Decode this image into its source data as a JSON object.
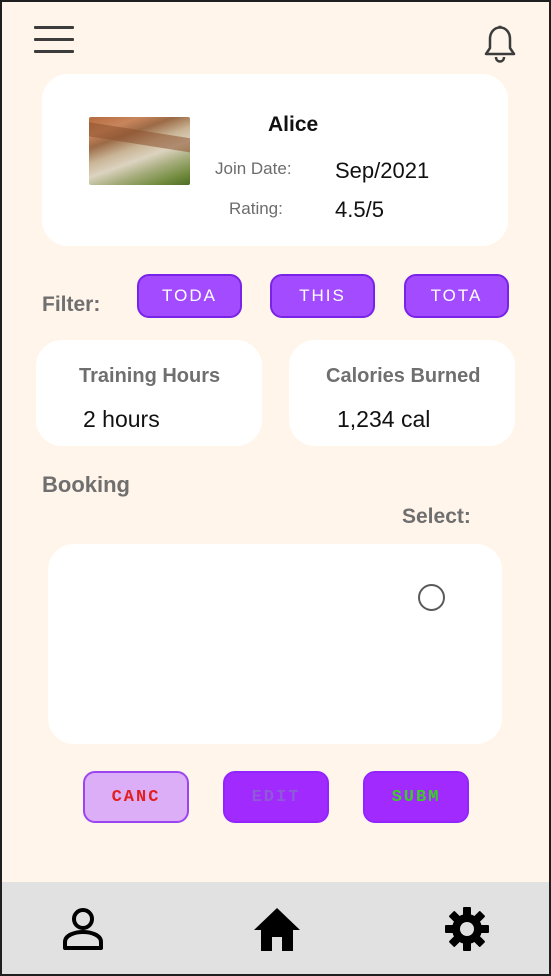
{
  "header": {
    "menu_icon": "hamburger-menu-icon",
    "notification_icon": "bell-icon"
  },
  "profile": {
    "name": "Alice",
    "join_label": "Join Date:",
    "join_value": "Sep/2021",
    "rating_label": "Rating:",
    "rating_value": "4.5/5"
  },
  "filter": {
    "label": "Filter:",
    "options": [
      "TODA",
      "THIS",
      "TOTA"
    ]
  },
  "stats": [
    {
      "title": "Training Hours",
      "value": "2 hours"
    },
    {
      "title": "Calories Burned",
      "value": "1,234 cal"
    }
  ],
  "booking": {
    "label": "Booking",
    "select_label": "Select:"
  },
  "actions": {
    "cancel": "CANC",
    "edit": "EDIT",
    "submit": "SUBM"
  },
  "colors": {
    "background": "#fff5ea",
    "button_purple": "#a34cff",
    "cancel_text": "#e02020",
    "submit_text": "#39d024",
    "nav_background": "#e1e1e1"
  },
  "bottom_nav": {
    "icons": [
      "person-icon",
      "home-icon",
      "gear-icon"
    ]
  }
}
